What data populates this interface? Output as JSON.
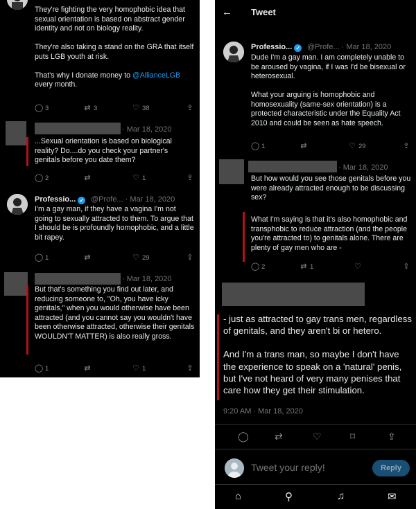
{
  "left": {
    "tweet1": {
      "lines": [
        "They're fighting the very homophobic idea that sexual orientation is based on abstract gender identity and not on biology reality.",
        "They're also taking a stand on the GRA that itself puts LGB youth at risk."
      ],
      "donate_prefix": "That's why I donate money to ",
      "donate_link": "@AllianceLGB",
      "donate_suffix": " every month.",
      "replies": "3",
      "retweets": "3",
      "likes": "38"
    },
    "tweet2": {
      "date": "· Mar 18, 2020",
      "text": "...Sexual orientation is based on biological reality?  Do....do you check your partner's genitals before you date them?",
      "replies": "2",
      "retweets": "",
      "likes": "1"
    },
    "tweet3": {
      "name": "Professio...",
      "handle": "@Profe... · Mar 18, 2020",
      "text": "I'm a gay man, if they have a vagina I'm not going to sexually attracted to them. To argue that I should be is profoundly homophobic, and a little bit rapey.",
      "replies": "1",
      "retweets": "",
      "likes": "29"
    },
    "tweet4": {
      "date": "· Mar 18, 2020",
      "text": "But that's something you find out later, and reducing someone to, \"Oh, you have icky genitals,\" when you would otherwise have been attracted (and you cannot say you wouldn't have been otherwise attracted, otherwise their genitals WOULDN'T MATTER) is also really gross.",
      "replies": "1",
      "retweets": "",
      "likes": "1"
    }
  },
  "right": {
    "header": {
      "title": "Tweet"
    },
    "tweet1": {
      "name": "Professio...",
      "handle": "@Profe... · Mar 18, 2020",
      "p1": "Dude I'm a gay man. I am completely unable to be aroused by vagina, if I was I'd be bisexual or heterosexual.",
      "p2": "What your arguing is homophobic and homosexuality (same-sex orientation) is a protected characteristic under the Equality Act 2010 and could be seen as hate speech.",
      "replies": "1",
      "retweets": "",
      "likes": "29"
    },
    "tweet2": {
      "date": "· Mar 18, 2020",
      "text": "But how would you see those genitals before you were already attracted enough to be discussing sex?",
      "quote": "What I'm saying is that it's also homophobic and transphobic to reduce attraction (and the people you're attracted to) to genitals alone. There are plenty of gay men who are -",
      "replies": "2",
      "retweets": "1",
      "likes": ""
    },
    "main": {
      "p1": "- just as attracted to gay trans men, regardless of genitals, and they aren't bi or hetero.",
      "p2": "And I'm a trans man, so maybe I don't have the experience to speak on a 'natural' penis, but I've not heard of very many penises that care how they get their stimulation.",
      "timestamp": "9:20 AM · Mar 18, 2020"
    },
    "reply": {
      "placeholder": "Tweet your reply!",
      "button": "Reply"
    }
  },
  "icons": {
    "reply": "comment-icon",
    "retweet": "retweet-icon",
    "like": "heart-icon",
    "share": "share-icon",
    "bookmark": "bookmark-icon",
    "verified": "verified-badge-icon",
    "back": "back-arrow-icon",
    "home": "home-icon",
    "search": "search-icon",
    "notifications": "bell-icon",
    "messages": "mail-icon"
  },
  "colors": {
    "background": "#000000",
    "link": "#1d9bf0",
    "annotation": "#b3121b",
    "reply_button": "#1a4f75"
  }
}
